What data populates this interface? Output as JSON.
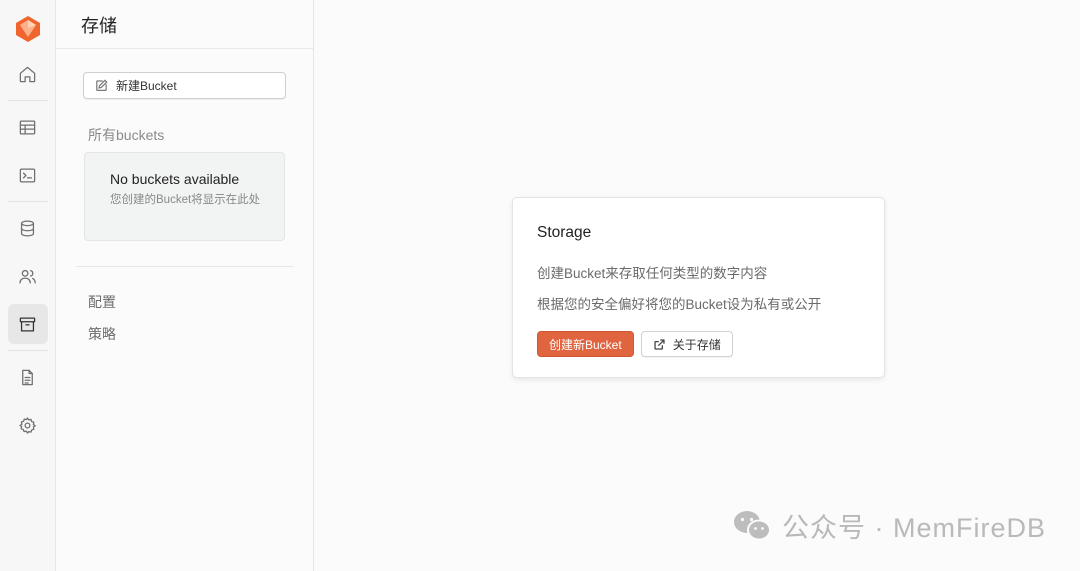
{
  "rail": {
    "items": [
      {
        "name": "home-icon"
      },
      {
        "name": "table-icon"
      },
      {
        "name": "terminal-icon"
      },
      {
        "name": "database-icon"
      },
      {
        "name": "users-icon"
      },
      {
        "name": "archive-icon",
        "active": true
      },
      {
        "name": "document-icon"
      },
      {
        "name": "gear-icon"
      }
    ]
  },
  "panel": {
    "title": "存储",
    "new_bucket_label": "新建Bucket",
    "all_buckets_label": "所有buckets",
    "empty_title": "No buckets available",
    "empty_desc": "您创建的Bucket将显示在此处",
    "links": [
      "配置",
      "策略"
    ]
  },
  "card": {
    "title": "Storage",
    "line1": "创建Bucket来存取任何类型的数字内容",
    "line2": "根据您的安全偏好将您的Bucket设为私有或公开",
    "primary_label": "创建新Bucket",
    "secondary_label": "关于存储"
  },
  "watermark": {
    "text": "公众号 · MemFireDB"
  },
  "colors": {
    "accent": "#e0643f",
    "logo": "#f0642d"
  }
}
